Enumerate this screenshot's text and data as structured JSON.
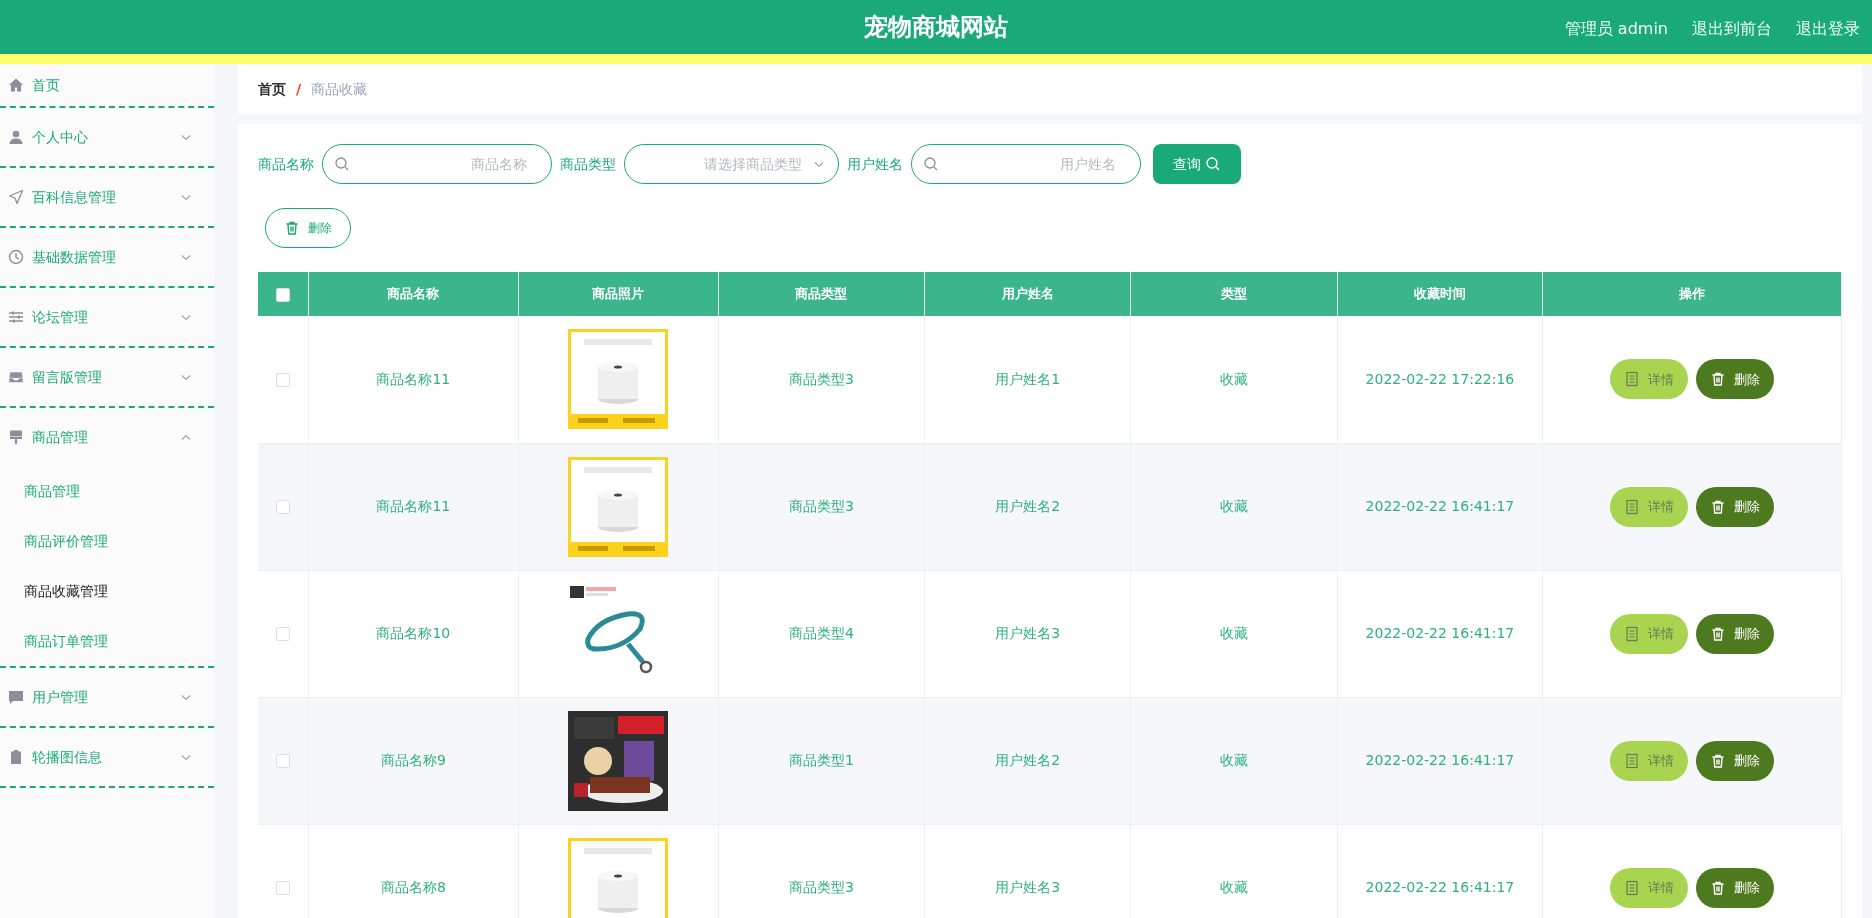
{
  "header": {
    "title": "宠物商城网站",
    "links": [
      "管理员 admin",
      "退出到前台",
      "退出登录"
    ]
  },
  "sidebar": {
    "items": [
      {
        "label": "首页",
        "kind": "link"
      },
      {
        "label": "个人中心",
        "kind": "menu",
        "expanded": false
      },
      {
        "label": "百科信息管理",
        "kind": "menu",
        "expanded": false
      },
      {
        "label": "基础数据管理",
        "kind": "menu",
        "expanded": false
      },
      {
        "label": "论坛管理",
        "kind": "menu",
        "expanded": false
      },
      {
        "label": "留言版管理",
        "kind": "menu",
        "expanded": false
      },
      {
        "label": "商品管理",
        "kind": "menu",
        "expanded": true,
        "children": [
          {
            "label": "商品管理",
            "selected": false
          },
          {
            "label": "商品评价管理",
            "selected": false
          },
          {
            "label": "商品收藏管理",
            "selected": true
          },
          {
            "label": "商品订单管理",
            "selected": false
          }
        ]
      },
      {
        "label": "用户管理",
        "kind": "menu",
        "expanded": false
      },
      {
        "label": "轮播图信息",
        "kind": "menu",
        "expanded": false
      }
    ]
  },
  "breadcrumb": {
    "separator": "/",
    "items": [
      "首页",
      "商品收藏"
    ]
  },
  "filters": [
    {
      "kind": "text",
      "label": "商品名称",
      "placeholder": "商品名称"
    },
    {
      "kind": "select",
      "label": "商品类型",
      "placeholder": "请选择商品类型"
    },
    {
      "kind": "text",
      "label": "用户姓名",
      "placeholder": "用户姓名"
    }
  ],
  "search_button": "查询",
  "bulk_delete_button": "删除",
  "table": {
    "select_all_checked": false,
    "columns": [
      "商品名称",
      "商品照片",
      "商品类型",
      "用户姓名",
      "类型",
      "收藏时间",
      "操作"
    ],
    "rows": [
      {
        "checked": false,
        "name": "商品名称11",
        "type": "商品类型3",
        "user": "用户姓名1",
        "category": "收藏",
        "time": "2022-02-22 17:22:16",
        "actions": [
          "详情",
          "删除"
        ]
      },
      {
        "checked": false,
        "name": "商品名称11",
        "type": "商品类型3",
        "user": "用户姓名2",
        "category": "收藏",
        "time": "2022-02-22 16:41:17",
        "actions": [
          "详情",
          "删除"
        ]
      },
      {
        "checked": false,
        "name": "商品名称10",
        "type": "商品类型4",
        "user": "用户姓名3",
        "category": "收藏",
        "time": "2022-02-22 16:41:17",
        "actions": [
          "详情",
          "删除"
        ]
      },
      {
        "checked": false,
        "name": "商品名称9",
        "type": "商品类型1",
        "user": "用户姓名2",
        "category": "收藏",
        "time": "2022-02-22 16:41:17",
        "actions": [
          "详情",
          "删除"
        ]
      },
      {
        "checked": false,
        "name": "商品名称8",
        "type": "商品类型3",
        "user": "用户姓名3",
        "category": "收藏",
        "time": "2022-02-22 16:41:17",
        "actions": [
          "详情",
          "删除"
        ]
      }
    ]
  }
}
